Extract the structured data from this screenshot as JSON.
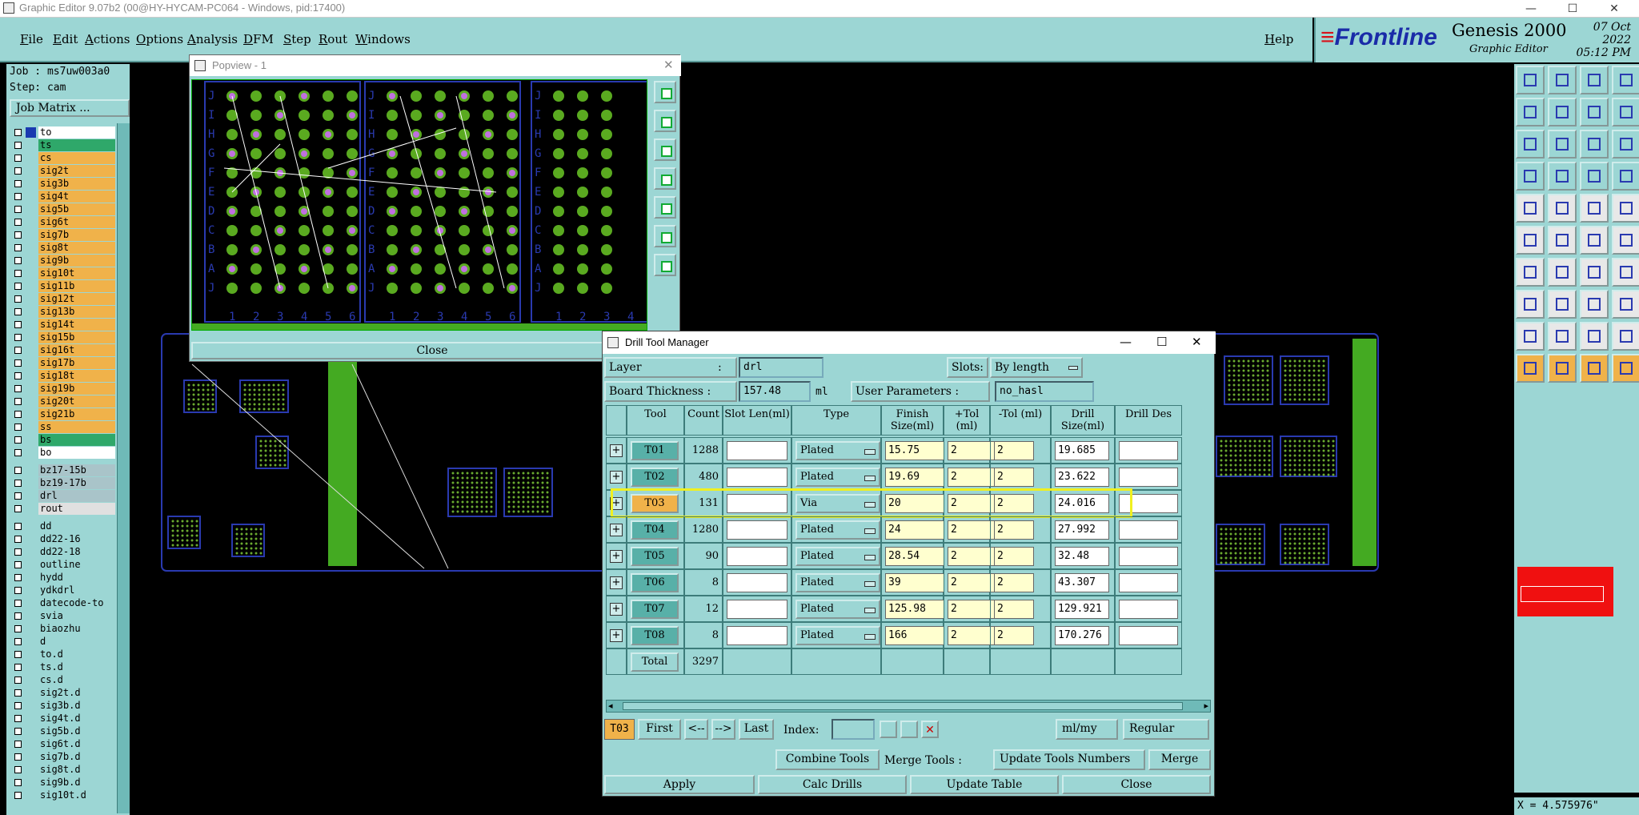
{
  "window": {
    "title": "Graphic Editor 9.07b2 (00@HY-HYCAM-PC064 - Windows, pid:17400)"
  },
  "menu": [
    "File",
    "Edit",
    "Actions",
    "Options",
    "Analysis",
    "DFM",
    "Step",
    "Rout",
    "Windows"
  ],
  "help": "Help",
  "brand": {
    "logo": "Frontline",
    "product": "Genesis 2000",
    "subtitle": "Graphic Editor",
    "date": "07 Oct 2022",
    "time": "05:12 PM"
  },
  "left": {
    "job": "Job : ms7uw003a0",
    "step": "Step: cam",
    "job_matrix": "Job Matrix ...",
    "layers": [
      {
        "name": "to",
        "color": "#ffffff"
      },
      {
        "name": "ts",
        "color": "#2fa86a"
      },
      {
        "name": "cs",
        "color": "#f0b24a"
      },
      {
        "name": "sig2t",
        "color": "#f0b24a"
      },
      {
        "name": "sig3b",
        "color": "#f0b24a"
      },
      {
        "name": "sig4t",
        "color": "#f0b24a"
      },
      {
        "name": "sig5b",
        "color": "#f0b24a"
      },
      {
        "name": "sig6t",
        "color": "#f0b24a"
      },
      {
        "name": "sig7b",
        "color": "#f0b24a"
      },
      {
        "name": "sig8t",
        "color": "#f0b24a"
      },
      {
        "name": "sig9b",
        "color": "#f0b24a"
      },
      {
        "name": "sig10t",
        "color": "#f0b24a"
      },
      {
        "name": "sig11b",
        "color": "#f0b24a"
      },
      {
        "name": "sig12t",
        "color": "#f0b24a"
      },
      {
        "name": "sig13b",
        "color": "#f0b24a"
      },
      {
        "name": "sig14t",
        "color": "#f0b24a"
      },
      {
        "name": "sig15b",
        "color": "#f0b24a"
      },
      {
        "name": "sig16t",
        "color": "#f0b24a"
      },
      {
        "name": "sig17b",
        "color": "#f0b24a"
      },
      {
        "name": "sig18t",
        "color": "#f0b24a"
      },
      {
        "name": "sig19b",
        "color": "#f0b24a"
      },
      {
        "name": "sig20t",
        "color": "#f0b24a"
      },
      {
        "name": "sig21b",
        "color": "#f0b24a"
      },
      {
        "name": "ss",
        "color": "#f0b24a"
      },
      {
        "name": "bs",
        "color": "#2fa86a"
      },
      {
        "name": "bo",
        "color": "#ffffff"
      },
      {
        "name": "bz17-15b",
        "color": "#a9c4c9"
      },
      {
        "name": "bz19-17b",
        "color": "#a9c4c9"
      },
      {
        "name": "drl",
        "color": "#a9c4c9"
      },
      {
        "name": "rout",
        "color": "#e0e0e0"
      },
      {
        "name": "dd",
        "color": "#9cd6d4"
      },
      {
        "name": "dd22-16",
        "color": "#9cd6d4"
      },
      {
        "name": "dd22-18",
        "color": "#9cd6d4"
      },
      {
        "name": "outline",
        "color": "#9cd6d4"
      },
      {
        "name": "hydd",
        "color": "#9cd6d4"
      },
      {
        "name": "ydkdrl",
        "color": "#9cd6d4"
      },
      {
        "name": "datecode-to",
        "color": "#9cd6d4"
      },
      {
        "name": "svia",
        "color": "#9cd6d4"
      },
      {
        "name": "biaozhu",
        "color": "#9cd6d4"
      },
      {
        "name": "d",
        "color": "#9cd6d4"
      },
      {
        "name": "to.d",
        "color": "#9cd6d4"
      },
      {
        "name": "ts.d",
        "color": "#9cd6d4"
      },
      {
        "name": "cs.d",
        "color": "#9cd6d4"
      },
      {
        "name": "sig2t.d",
        "color": "#9cd6d4"
      },
      {
        "name": "sig3b.d",
        "color": "#9cd6d4"
      },
      {
        "name": "sig4t.d",
        "color": "#9cd6d4"
      },
      {
        "name": "sig5b.d",
        "color": "#9cd6d4"
      },
      {
        "name": "sig6t.d",
        "color": "#9cd6d4"
      },
      {
        "name": "sig7b.d",
        "color": "#9cd6d4"
      },
      {
        "name": "sig8t.d",
        "color": "#9cd6d4"
      },
      {
        "name": "sig9b.d",
        "color": "#9cd6d4"
      },
      {
        "name": "sig10t.d",
        "color": "#9cd6d4"
      }
    ]
  },
  "popview": {
    "title": "Popview - 1",
    "close": "Close",
    "row_letters": "JIHGFEDCBAJ",
    "col_numbers": "123456"
  },
  "dtm": {
    "title": "Drill Tool Manager",
    "layer_label": "Layer",
    "layer_value": "drl",
    "slots_label": "Slots:",
    "slots_value": "By length",
    "thickness_label": "Board Thickness :",
    "thickness_value": "157.48",
    "thickness_unit": "ml",
    "user_params_label": "User Parameters :",
    "user_params_value": "no_hasl",
    "headers": [
      "Tool",
      "Count",
      "Slot Len(ml)",
      "Type",
      "Finish Size(ml)",
      "+Tol (ml)",
      "-Tol (ml)",
      "Drill Size(ml)",
      "Drill Des"
    ],
    "rows": [
      {
        "tool": "T01",
        "count": "1288",
        "type": "Plated",
        "finish": "15.75",
        "ptol": "2",
        "mtol": "2",
        "drill": "19.685"
      },
      {
        "tool": "T02",
        "count": "480",
        "type": "Plated",
        "finish": "19.69",
        "ptol": "2",
        "mtol": "2",
        "drill": "23.622"
      },
      {
        "tool": "T03",
        "count": "131",
        "type": "Via",
        "finish": "20",
        "ptol": "2",
        "mtol": "2",
        "drill": "24.016"
      },
      {
        "tool": "T04",
        "count": "1280",
        "type": "Plated",
        "finish": "24",
        "ptol": "2",
        "mtol": "2",
        "drill": "27.992"
      },
      {
        "tool": "T05",
        "count": "90",
        "type": "Plated",
        "finish": "28.54",
        "ptol": "2",
        "mtol": "2",
        "drill": "32.48"
      },
      {
        "tool": "T06",
        "count": "8",
        "type": "Plated",
        "finish": "39",
        "ptol": "2",
        "mtol": "2",
        "drill": "43.307"
      },
      {
        "tool": "T07",
        "count": "12",
        "type": "Plated",
        "finish": "125.98",
        "ptol": "2",
        "mtol": "2",
        "drill": "129.921"
      },
      {
        "tool": "T08",
        "count": "8",
        "type": "Plated",
        "finish": "166",
        "ptol": "2",
        "mtol": "2",
        "drill": "170.276"
      }
    ],
    "total_label": "Total",
    "total_count": "3297",
    "nav": {
      "current": "T03",
      "first": "First",
      "prev": "<--",
      "next": "-->",
      "last": "Last",
      "index_label": "Index:",
      "units": "ml/my",
      "mode": "Regular"
    },
    "combine": "Combine Tools",
    "merge_label": "Merge Tools :",
    "merge_value": "Update Tools Numbers",
    "merge": "Merge",
    "apply": "Apply",
    "calc": "Calc Drills",
    "update": "Update Table",
    "close": "Close"
  },
  "status": {
    "coord": "X = 4.575976\""
  }
}
